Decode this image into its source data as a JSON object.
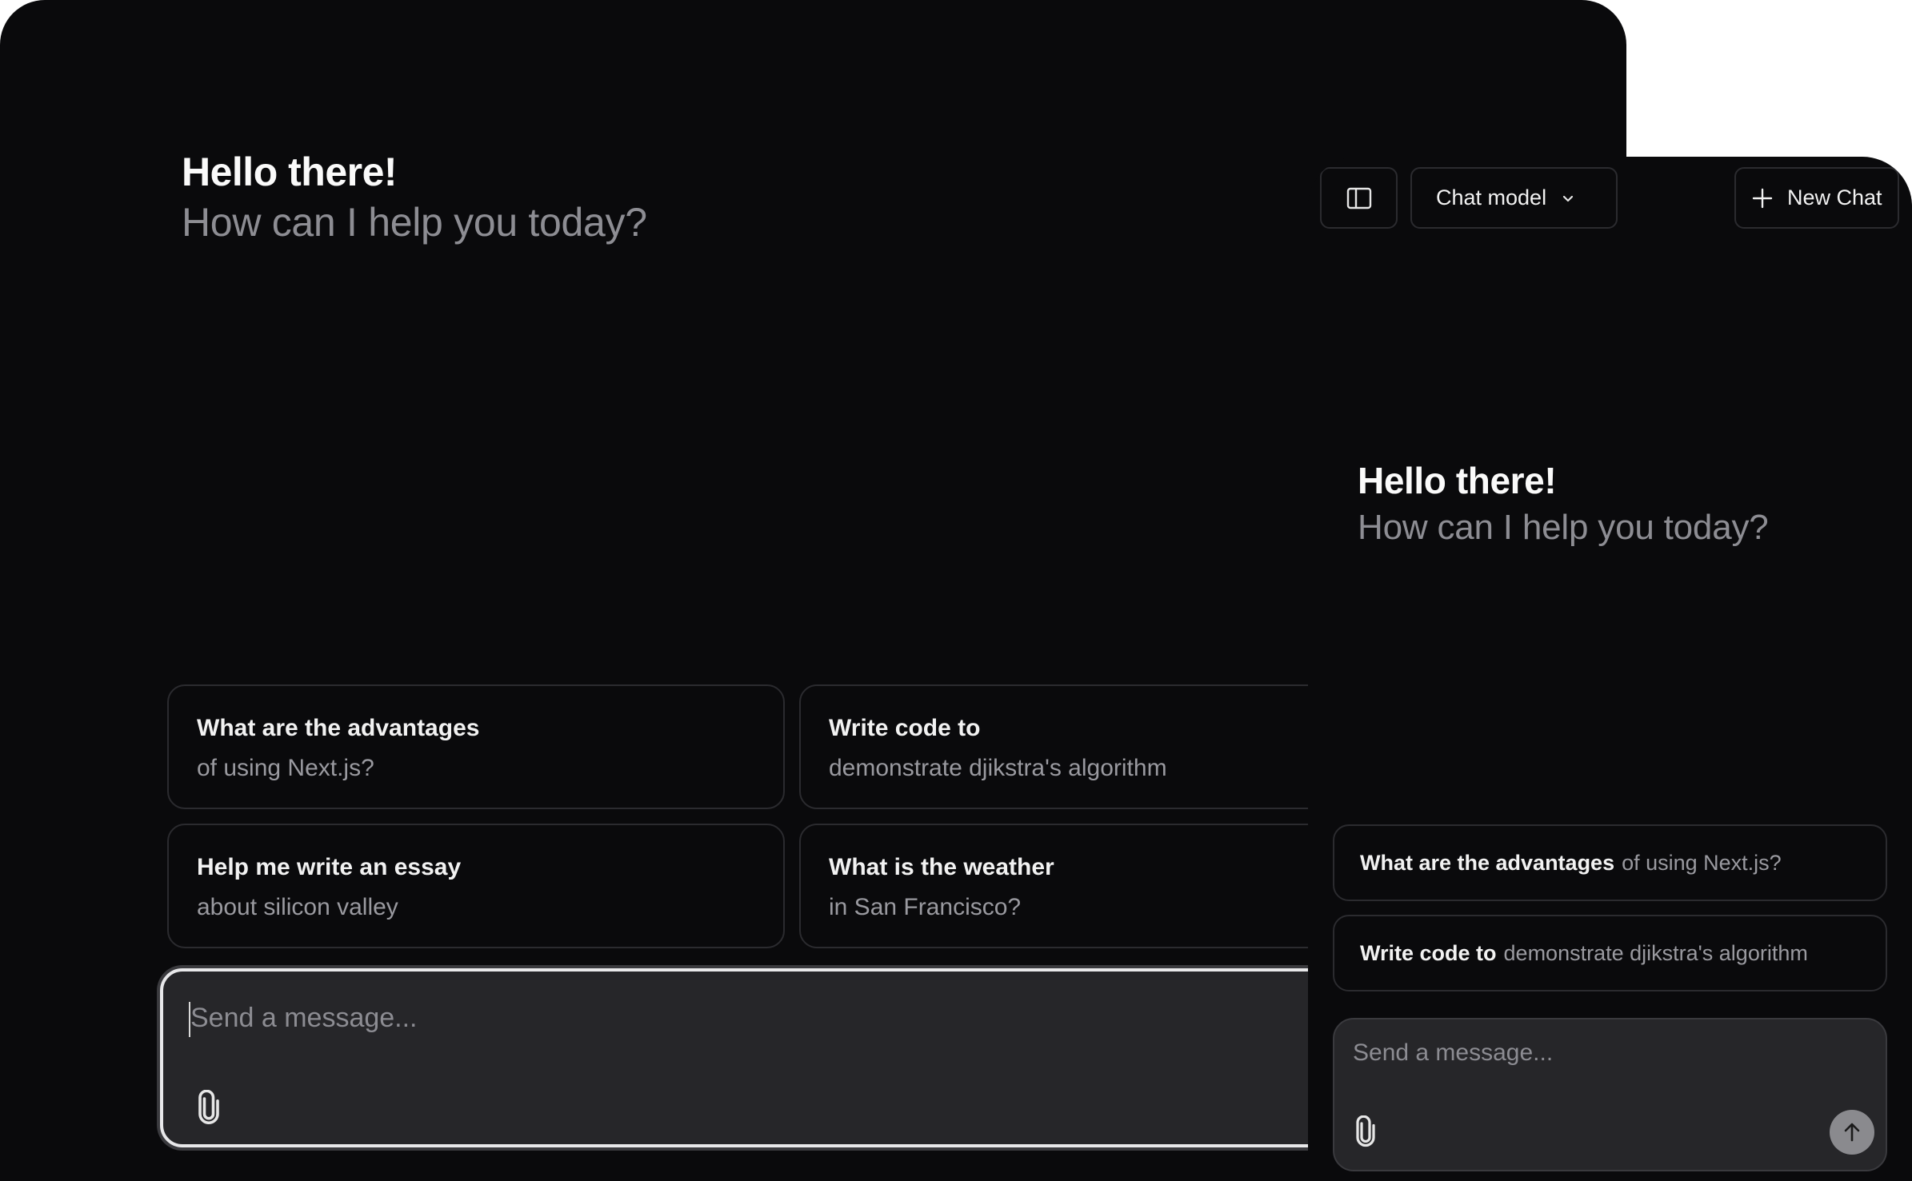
{
  "desktop": {
    "greeting": {
      "title": "Hello there!",
      "subtitle": "How can I help you today?"
    },
    "suggestions": [
      {
        "title": "What are the advantages",
        "subtitle": "of using Next.js?"
      },
      {
        "title": "Write code to",
        "subtitle": "demonstrate djikstra's algorithm"
      },
      {
        "title": "Help me write an essay",
        "subtitle": "about silicon valley"
      },
      {
        "title": "What is the weather",
        "subtitle": "in San Francisco?"
      }
    ],
    "composer": {
      "placeholder": "Send a message...",
      "attach_icon": "paperclip-icon"
    }
  },
  "mobile": {
    "header": {
      "sidebar_toggle_icon": "sidebar-icon",
      "model_selector_label": "Chat model",
      "model_selector_icon": "chevron-down-icon",
      "new_chat_label": "New Chat",
      "new_chat_icon": "plus-icon"
    },
    "greeting": {
      "title": "Hello there!",
      "subtitle": "How can I help you today?"
    },
    "suggestions": [
      {
        "title": "What are the advantages",
        "subtitle": "of using Next.js?"
      },
      {
        "title": "Write code to",
        "subtitle": "demonstrate djikstra's algorithm"
      }
    ],
    "composer": {
      "placeholder": "Send a message...",
      "attach_icon": "paperclip-icon",
      "send_icon": "arrow-up-icon"
    }
  }
}
